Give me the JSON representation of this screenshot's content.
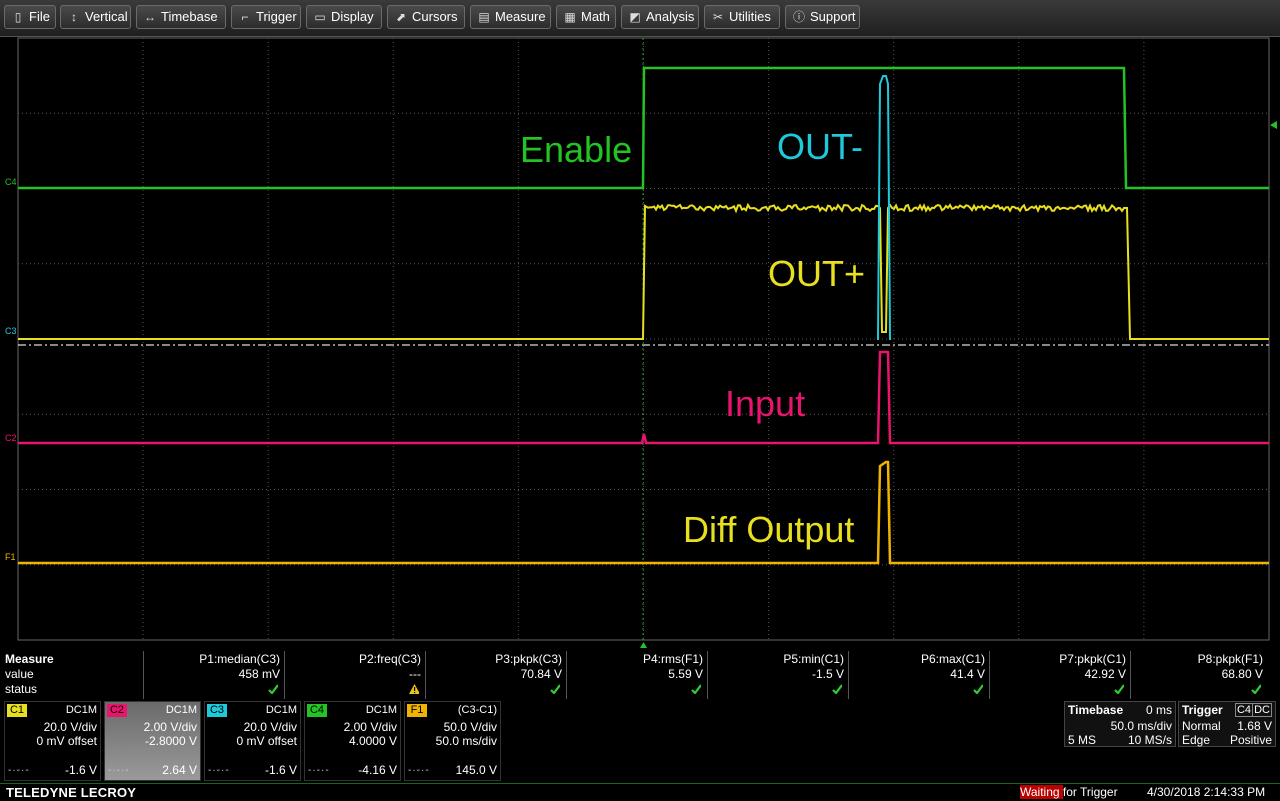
{
  "menu": [
    {
      "label": "File",
      "icon": "file-icon"
    },
    {
      "label": "Vertical",
      "icon": "vertical-arrows-icon"
    },
    {
      "label": "Timebase",
      "icon": "horizontal-arrows-icon"
    },
    {
      "label": "Trigger",
      "icon": "trigger-icon"
    },
    {
      "label": "Display",
      "icon": "display-icon"
    },
    {
      "label": "Cursors",
      "icon": "cursor-icon"
    },
    {
      "label": "Measure",
      "icon": "measure-icon"
    },
    {
      "label": "Math",
      "icon": "calculator-icon"
    },
    {
      "label": "Analysis",
      "icon": "chart-icon"
    },
    {
      "label": "Utilities",
      "icon": "tools-icon"
    },
    {
      "label": "Support",
      "icon": "info-icon"
    }
  ],
  "traces": {
    "enable": {
      "label": "Enable",
      "color": "#22c322"
    },
    "out_minus": {
      "label": "OUT-",
      "color": "#1ec9dc"
    },
    "out_plus": {
      "label": "OUT+",
      "color": "#e8e01e"
    },
    "input": {
      "label": "Input",
      "color": "#e8146e"
    },
    "diff": {
      "label": "Diff Output",
      "color": "#e8e01e",
      "trace_color": "#f0b400"
    }
  },
  "channel_tags": {
    "c4": "C4",
    "c3": "C3",
    "c1": "C1",
    "c2": "C2",
    "f1": "F1"
  },
  "measure": {
    "heading": "Measure",
    "rows": [
      "value",
      "status"
    ],
    "params": [
      {
        "name": "P1:median(C3)",
        "value": "458 mV",
        "status": "ok"
      },
      {
        "name": "P2:freq(C3)",
        "value": "---",
        "status": "warn"
      },
      {
        "name": "P3:pkpk(C3)",
        "value": "70.84 V",
        "status": "ok"
      },
      {
        "name": "P4:rms(F1)",
        "value": "5.59 V",
        "status": "ok"
      },
      {
        "name": "P5:min(C1)",
        "value": "-1.5 V",
        "status": "ok"
      },
      {
        "name": "P6:max(C1)",
        "value": "41.4 V",
        "status": "ok"
      },
      {
        "name": "P7:pkpk(C1)",
        "value": "42.92 V",
        "status": "ok"
      },
      {
        "name": "P8:pkpk(F1)",
        "value": "68.80 V",
        "status": "ok"
      }
    ]
  },
  "descriptors": [
    {
      "id": "C1",
      "color": "#e8e01e",
      "coupling": "DC1M",
      "vdiv": "20.0 V/div",
      "offset": "0 mV offset",
      "foot": "-1.6 V",
      "selected": false
    },
    {
      "id": "C2",
      "color": "#e8146e",
      "coupling": "DC1M",
      "vdiv": "2.00 V/div",
      "offset": "-2.8000 V",
      "foot": "2.64 V",
      "selected": true
    },
    {
      "id": "C3",
      "color": "#1ec9dc",
      "coupling": "DC1M",
      "vdiv": "20.0 V/div",
      "offset": "0 mV offset",
      "foot": "-1.6 V",
      "selected": false
    },
    {
      "id": "C4",
      "color": "#22c322",
      "coupling": "DC1M",
      "vdiv": "2.00 V/div",
      "offset": "4.0000 V",
      "foot": "-4.16 V",
      "selected": false
    },
    {
      "id": "F1",
      "color": "#f0b400",
      "coupling": "(C3-C1)",
      "vdiv": "50.0 V/div",
      "offset": "50.0 ms/div",
      "foot": "145.0 V",
      "selected": false
    }
  ],
  "timebase": {
    "heading": "Timebase",
    "delay": "0 ms",
    "tdiv": "50.0 ms/div",
    "samples": "5 MS",
    "rate": "10 MS/s"
  },
  "trigger": {
    "heading": "Trigger",
    "source": "C4",
    "coupling": "DC",
    "mode": "Normal",
    "level": "1.68 V",
    "type": "Edge",
    "slope": "Positive"
  },
  "status": {
    "brand": "TELEDYNE LECROY",
    "waiting_a": "Waiting ",
    "waiting_b": "for Trigger",
    "datetime": "4/30/2018 2:14:33 PM"
  }
}
